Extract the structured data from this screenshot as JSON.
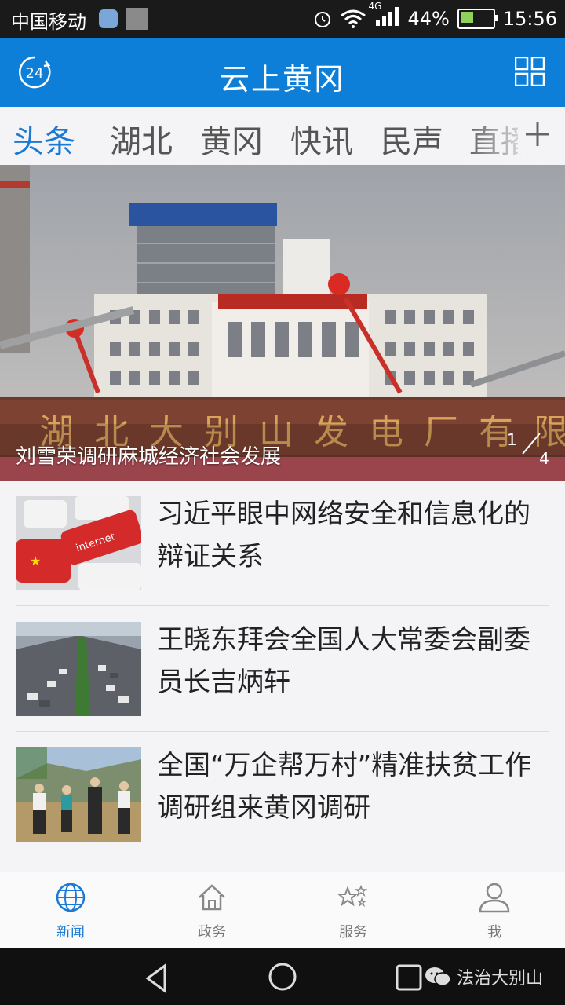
{
  "status_bar": {
    "carrier": "中国移动",
    "network": "4G",
    "battery": "44%",
    "battery_level": 0.44,
    "time": "15:56"
  },
  "header": {
    "title": "云上黄冈",
    "badge": "24"
  },
  "tabs": [
    {
      "label": "头条",
      "active": true
    },
    {
      "label": "湖北"
    },
    {
      "label": "黄冈"
    },
    {
      "label": "快讯"
    },
    {
      "label": "民声"
    },
    {
      "label": "直播"
    }
  ],
  "hero": {
    "caption": "刘雪荣调研麻城经济社会发展",
    "sign_text": "湖北大别山发电厂有限",
    "current": "1",
    "total": "4"
  },
  "news": [
    {
      "headline": "习近平眼中网络安全和信息化的辩证关系",
      "thumb_text": "internet"
    },
    {
      "headline": "王晓东拜会全国人大常委会副委员长吉炳轩"
    },
    {
      "headline": "全国“万企帮万村”精准扶贫工作调研组来黄冈调研"
    }
  ],
  "bottom_nav": [
    {
      "label": "新闻",
      "icon": "globe-icon",
      "active": true
    },
    {
      "label": "政务",
      "icon": "home-icon"
    },
    {
      "label": "服务",
      "icon": "stars-icon"
    },
    {
      "label": "我",
      "icon": "user-icon"
    }
  ],
  "watermark": "法治大别山",
  "colors": {
    "primary": "#0d7fd8",
    "active_tab": "#1b7ad6",
    "status_bar": "#1a1a1a"
  }
}
